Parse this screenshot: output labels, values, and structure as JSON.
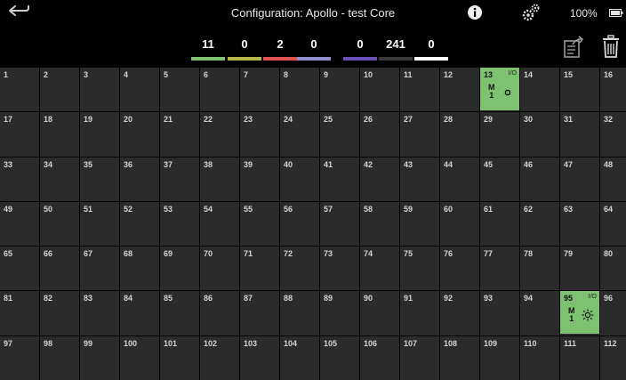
{
  "header": {
    "title": "Configuration: Apollo - test Core",
    "battery": "100%"
  },
  "counters": [
    {
      "value": "11",
      "color": "#7dc271"
    },
    {
      "value": "0",
      "color": "#b8b84a"
    },
    {
      "value": "2",
      "color": "#e05454"
    },
    {
      "value": "0",
      "color": "#8f8fcf"
    },
    {
      "value": "0",
      "color": "#6a4fb8"
    },
    {
      "value": "241",
      "color": "#3a3a3a"
    },
    {
      "value": "0",
      "color": "#ffffff"
    }
  ],
  "grid": {
    "cells": [
      "1",
      "2",
      "3",
      "4",
      "5",
      "6",
      "7",
      "8",
      "9",
      "10",
      "11",
      "12",
      "13",
      "14",
      "15",
      "16",
      "17",
      "18",
      "19",
      "20",
      "21",
      "22",
      "23",
      "24",
      "25",
      "26",
      "27",
      "28",
      "29",
      "30",
      "31",
      "32",
      "33",
      "34",
      "35",
      "36",
      "37",
      "38",
      "39",
      "40",
      "41",
      "42",
      "43",
      "44",
      "45",
      "46",
      "47",
      "48",
      "49",
      "50",
      "51",
      "52",
      "53",
      "54",
      "55",
      "56",
      "57",
      "58",
      "59",
      "60",
      "61",
      "62",
      "63",
      "64",
      "65",
      "66",
      "67",
      "68",
      "69",
      "70",
      "71",
      "72",
      "73",
      "74",
      "75",
      "76",
      "77",
      "78",
      "79",
      "80",
      "81",
      "82",
      "83",
      "84",
      "85",
      "86",
      "87",
      "88",
      "89",
      "90",
      "91",
      "92",
      "93",
      "94",
      "95",
      "96",
      "97",
      "98",
      "99",
      "100",
      "101",
      "102",
      "103",
      "104",
      "105",
      "106",
      "107",
      "108",
      "109",
      "110",
      "111",
      "112"
    ],
    "active": [
      {
        "index": 12,
        "number": "13",
        "io": "I/O",
        "mode": "M",
        "channel": "1",
        "icon": "circle-icon"
      },
      {
        "index": 94,
        "number": "95",
        "io": "I/O",
        "mode": "M",
        "channel": "1",
        "icon": "sun-icon"
      }
    ]
  }
}
